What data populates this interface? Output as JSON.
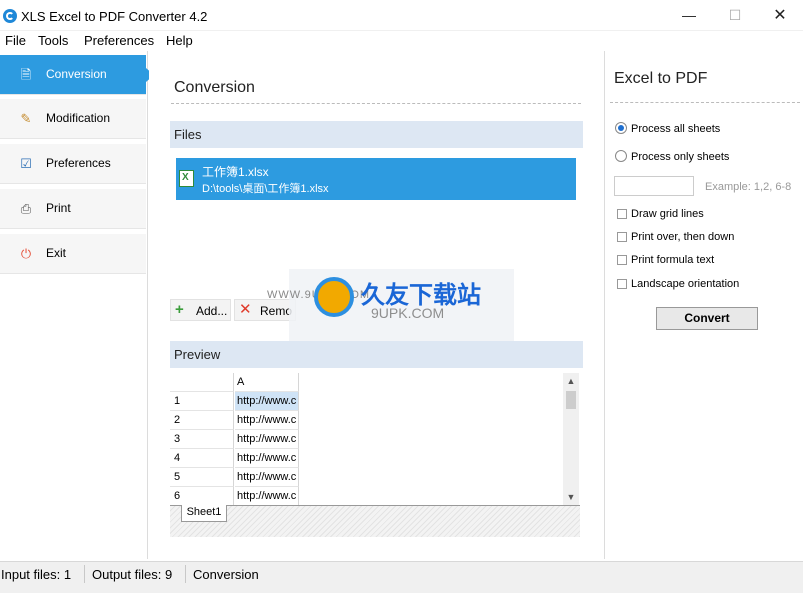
{
  "window": {
    "title": "XLS Excel to PDF Converter 4.2",
    "minimize": "—",
    "maximize": "☐",
    "close": "✕"
  },
  "menu": [
    "File",
    "Tools",
    "Preferences",
    "Help"
  ],
  "sidebar": {
    "items": [
      {
        "label": "Conversion",
        "icon": "document-icon",
        "glyph": "🗎",
        "active": true
      },
      {
        "label": "Modification",
        "icon": "edit-icon",
        "glyph": "✎",
        "active": false
      },
      {
        "label": "Preferences",
        "icon": "checklist-icon",
        "glyph": "☑",
        "active": false
      },
      {
        "label": "Print",
        "icon": "printer-icon",
        "glyph": "⎙",
        "active": false
      },
      {
        "label": "Exit",
        "icon": "power-icon",
        "glyph": "⏻",
        "active": false
      }
    ]
  },
  "main": {
    "title": "Conversion",
    "files_label": "Files",
    "file": {
      "name": "工作簿1.xlsx",
      "path": "D:\\tools\\桌面\\工作簿1.xlsx"
    },
    "add_label": "Add...",
    "remove_label": "Remo",
    "preview_label": "Preview",
    "grid": {
      "column_header": "A",
      "rows": [
        {
          "num": "1",
          "value": "http://www.c"
        },
        {
          "num": "2",
          "value": "http://www.c"
        },
        {
          "num": "3",
          "value": "http://www.c"
        },
        {
          "num": "4",
          "value": "http://www.c"
        },
        {
          "num": "5",
          "value": "http://www.c"
        },
        {
          "num": "6",
          "value": "http://www.c"
        }
      ]
    },
    "sheet_tab": "Sheet1"
  },
  "watermark": {
    "site": "WWW.9UPK.COM",
    "text": "久友下载站",
    "sub": "9UPK.COM"
  },
  "right": {
    "title": "Excel to PDF",
    "process_all": "Process all sheets",
    "process_only": "Process only sheets",
    "sheets_hint": "Example: 1,2, 6-8",
    "sheets_value": "",
    "options": [
      {
        "label": "Draw grid lines",
        "checked": false
      },
      {
        "label": "Print over, then down",
        "checked": false
      },
      {
        "label": "Print formula text",
        "checked": false
      },
      {
        "label": "Landscape orientation",
        "checked": false
      }
    ],
    "convert": "Convert"
  },
  "status": {
    "input_files": "Input files: 1",
    "output_files": "Output files: 9",
    "mode": "Conversion"
  }
}
